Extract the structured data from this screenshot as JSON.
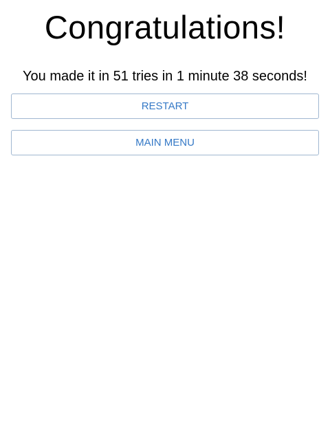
{
  "result": {
    "title": "Congratulations!",
    "message": "You made it in 51 tries in 1 minute 38 seconds!"
  },
  "actions": {
    "restart_label": "RESTART",
    "main_menu_label": "MAIN MENU"
  },
  "colors": {
    "accent": "#3579c6",
    "button_border": "#9fb6d0",
    "background": "#ffffff",
    "text": "#000000"
  }
}
